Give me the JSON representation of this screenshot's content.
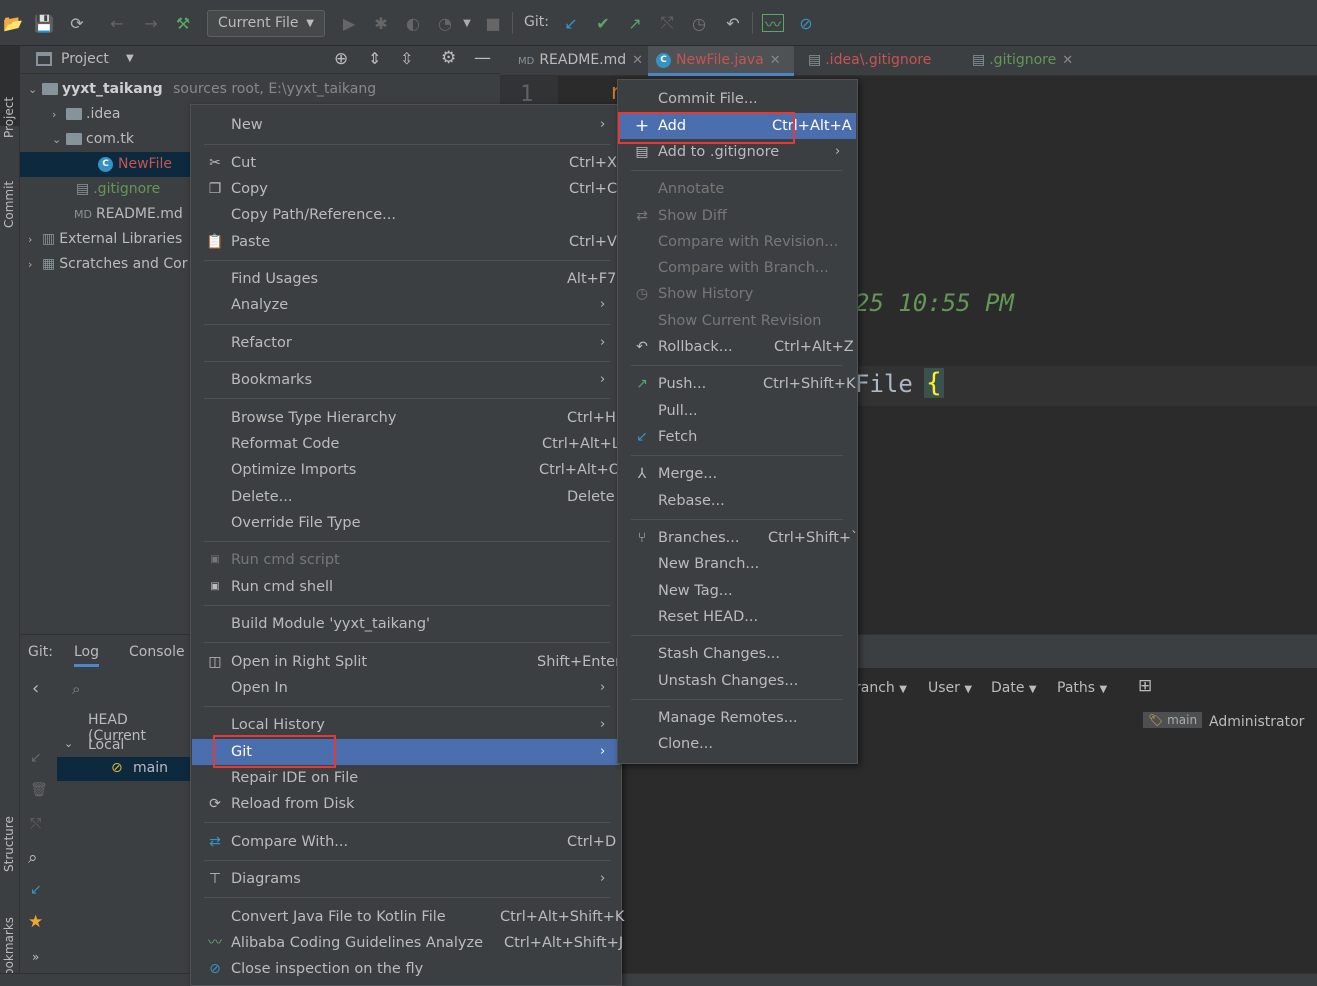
{
  "toolbar": {
    "run_config": "Current File",
    "git_label": "Git:"
  },
  "left_stripe": {
    "project": "Project",
    "commit": "Commit",
    "structure": "Structure",
    "bookmarks": "Bookmarks"
  },
  "project_panel": {
    "title": "Project",
    "tree": [
      {
        "label": "yyxt_taikang",
        "extra": "sources root,  E:\\yyxt_taikang"
      },
      {
        "label": ".idea"
      },
      {
        "label": "com.tk"
      },
      {
        "label": "NewFile"
      },
      {
        "label": ".gitignore"
      },
      {
        "label": "README.md"
      },
      {
        "label": "External Libraries"
      },
      {
        "label": "Scratches and Cor"
      }
    ]
  },
  "editor_tabs": [
    {
      "label": "README.md"
    },
    {
      "label": "NewFile.java"
    },
    {
      "label": ".idea\\.gitignore"
    },
    {
      "label": ".gitignore"
    }
  ],
  "editor": {
    "line_number": "1",
    "partial_char": "r",
    "timestamp_fragment": "25 10:55 PM",
    "class_fragment": "File",
    "brace": "{"
  },
  "git_panel": {
    "label": "Git:",
    "tabs": [
      "Log",
      "Console"
    ],
    "branches": {
      "head": "HEAD (Current",
      "local": "Local",
      "main": "main"
    },
    "filters": [
      "ranch",
      "User",
      "Date",
      "Paths"
    ],
    "commit_row": {
      "tag": "main",
      "author": "Administrator"
    }
  },
  "context_menu": [
    {
      "label": "New",
      "submenu": true
    },
    {
      "label": "Cut",
      "shortcut": "Ctrl+X",
      "icon": "scissors-icon"
    },
    {
      "label": "Copy",
      "shortcut": "Ctrl+C",
      "icon": "copy-icon"
    },
    {
      "label": "Copy Path/Reference..."
    },
    {
      "label": "Paste",
      "shortcut": "Ctrl+V",
      "icon": "paste-icon"
    },
    {
      "label": "Find Usages",
      "shortcut": "Alt+F7"
    },
    {
      "label": "Analyze",
      "submenu": true
    },
    {
      "label": "Refactor",
      "submenu": true
    },
    {
      "label": "Bookmarks",
      "submenu": true
    },
    {
      "label": "Browse Type Hierarchy",
      "shortcut": "Ctrl+H"
    },
    {
      "label": "Reformat Code",
      "shortcut": "Ctrl+Alt+L"
    },
    {
      "label": "Optimize Imports",
      "shortcut": "Ctrl+Alt+O"
    },
    {
      "label": "Delete...",
      "shortcut": "Delete"
    },
    {
      "label": "Override File Type"
    },
    {
      "label": "Run cmd script",
      "disabled": true
    },
    {
      "label": "Run cmd shell"
    },
    {
      "label": "Build Module 'yyxt_taikang'"
    },
    {
      "label": "Open in Right Split",
      "shortcut": "Shift+Enter"
    },
    {
      "label": "Open In",
      "submenu": true
    },
    {
      "label": "Local History",
      "submenu": true
    },
    {
      "label": "Git",
      "submenu": true,
      "highlighted": true
    },
    {
      "label": "Repair IDE on File"
    },
    {
      "label": "Reload from Disk"
    },
    {
      "label": "Compare With...",
      "shortcut": "Ctrl+D"
    },
    {
      "label": "Diagrams",
      "submenu": true
    },
    {
      "label": "Convert Java File to Kotlin File",
      "shortcut": "Ctrl+Alt+Shift+K"
    },
    {
      "label": "Alibaba Coding Guidelines Analyze",
      "shortcut": "Ctrl+Alt+Shift+J"
    },
    {
      "label": "Close inspection on the fly"
    }
  ],
  "git_submenu": [
    {
      "label": "Commit File..."
    },
    {
      "label": "Add",
      "shortcut": "Ctrl+Alt+A",
      "highlighted": true
    },
    {
      "label": "Add to .gitignore",
      "submenu": true
    },
    {
      "label": "Annotate",
      "disabled": true
    },
    {
      "label": "Show Diff",
      "disabled": true
    },
    {
      "label": "Compare with Revision...",
      "disabled": true
    },
    {
      "label": "Compare with Branch...",
      "disabled": true
    },
    {
      "label": "Show History",
      "disabled": true
    },
    {
      "label": "Show Current Revision",
      "disabled": true
    },
    {
      "label": "Rollback...",
      "shortcut": "Ctrl+Alt+Z"
    },
    {
      "label": "Push...",
      "shortcut": "Ctrl+Shift+K"
    },
    {
      "label": "Pull..."
    },
    {
      "label": "Fetch"
    },
    {
      "label": "Merge..."
    },
    {
      "label": "Rebase..."
    },
    {
      "label": "Branches...",
      "shortcut": "Ctrl+Shift+`"
    },
    {
      "label": "New Branch..."
    },
    {
      "label": "New Tag..."
    },
    {
      "label": "Reset HEAD..."
    },
    {
      "label": "Stash Changes..."
    },
    {
      "label": "Unstash Changes..."
    },
    {
      "label": "Manage Remotes..."
    },
    {
      "label": "Clone..."
    }
  ],
  "colors": {
    "highlight": "#4b6eaf",
    "red_box": "#e53935",
    "modified_file": "#c75450",
    "added_file": "#629755"
  }
}
